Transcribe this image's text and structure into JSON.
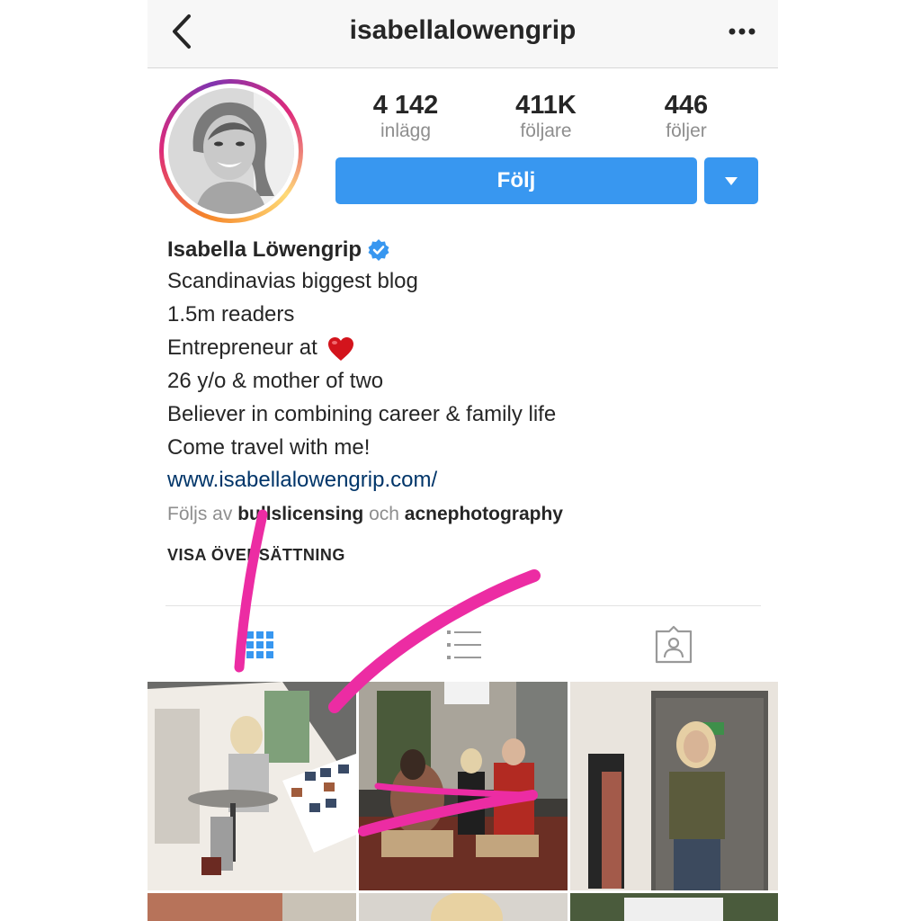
{
  "header": {
    "username": "isabellalowengrip",
    "back_icon": "chevron-left-icon",
    "more_icon": "more-horizontal-icon"
  },
  "stats": [
    {
      "value": "4 142",
      "label": "inlägg"
    },
    {
      "value": "411K",
      "label": "följare"
    },
    {
      "value": "446",
      "label": "följer"
    }
  ],
  "actions": {
    "follow_label": "Följ",
    "accent_color": "#3897f0"
  },
  "bio": {
    "name": "Isabella Löwengrip",
    "verified": true,
    "lines": [
      "Scandinavias biggest blog",
      "1.5m readers",
      "Entrepreneur at",
      "26 y/o & mother of two",
      "Believer in combining career & family life",
      "Come travel with me!"
    ],
    "link": "www.isabellalowengrip.com/",
    "followed_prefix": "Följs av",
    "followed_user_1": "bullslicensing",
    "followed_conj": "och",
    "followed_user_2": "acnephotography",
    "translate_label": "VISA ÖVERSÄTTNING"
  },
  "tabs": [
    {
      "icon": "grid-icon",
      "active": true
    },
    {
      "icon": "list-icon",
      "active": false
    },
    {
      "icon": "tagged-person-icon",
      "active": false
    }
  ],
  "annotation_color": "#ec2ca3"
}
